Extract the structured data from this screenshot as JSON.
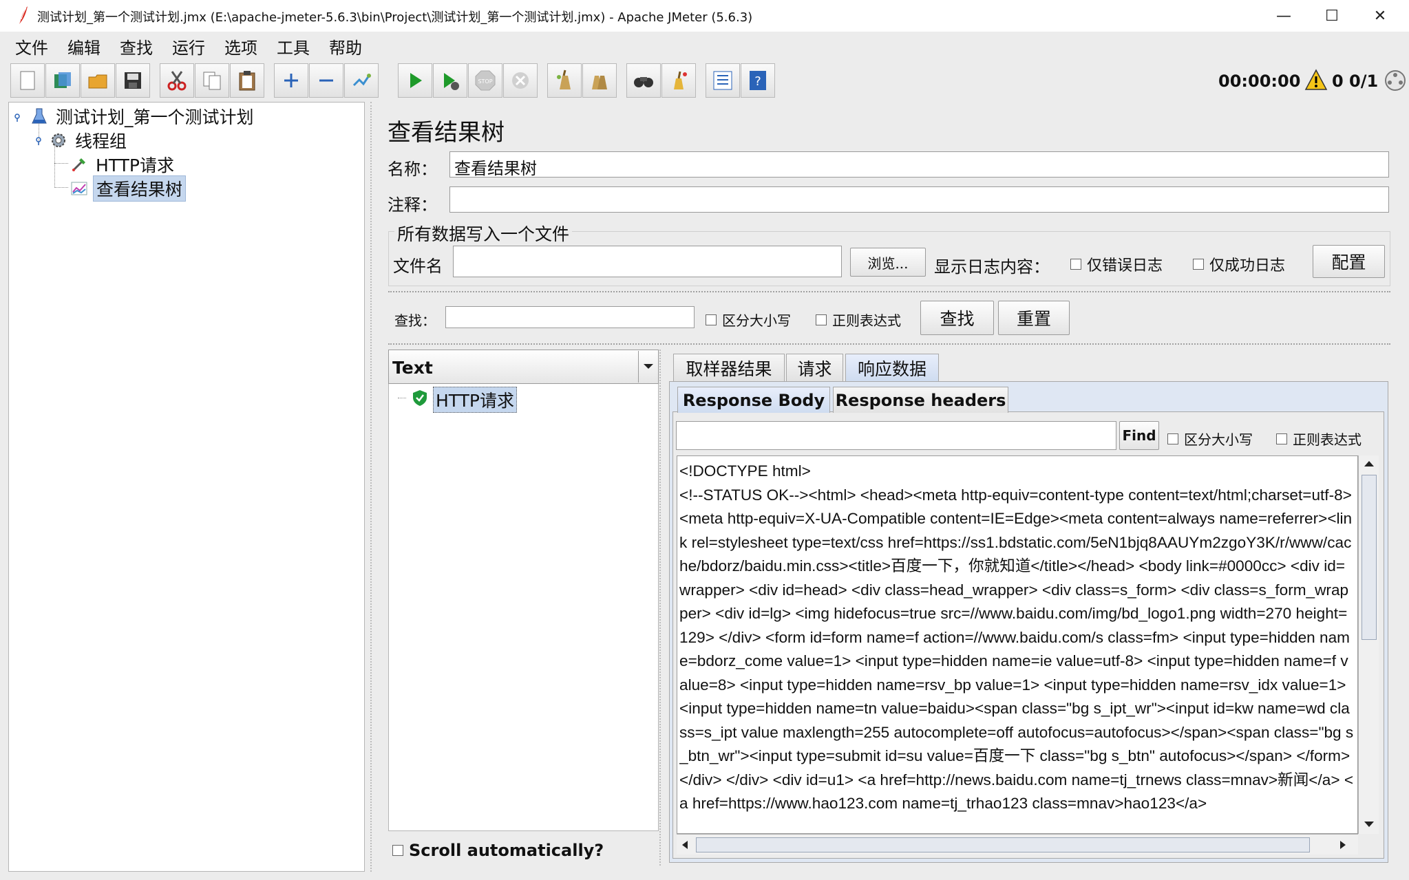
{
  "window": {
    "title": "测试计划_第一个测试计划.jmx (E:\\apache-jmeter-5.6.3\\bin\\Project\\测试计划_第一个测试计划.jmx) - Apache JMeter (5.6.3)",
    "minimize": "—",
    "maximize": "☐",
    "close": "✕"
  },
  "menu": [
    "文件",
    "编辑",
    "查找",
    "运行",
    "选项",
    "工具",
    "帮助"
  ],
  "toolbar": {
    "timer": "00:00:00",
    "error_count": "0",
    "threads": "0/1",
    "icons": [
      "new-icon",
      "templates-icon",
      "open-icon",
      "save-icon",
      "cut-icon",
      "copy-icon",
      "paste-icon",
      "expand-icon",
      "collapse-icon",
      "toggle-icon",
      "start-icon",
      "start-no-pause-icon",
      "stop-icon",
      "shutdown-icon",
      "clear-icon",
      "clear-all-icon",
      "search-icon",
      "reset-search-icon",
      "function-helper-icon",
      "help-icon"
    ]
  },
  "tree": {
    "items": [
      {
        "label": "测试计划_第一个测试计划",
        "icon": "test-plan-icon"
      },
      {
        "label": "线程组",
        "icon": "thread-group-icon"
      },
      {
        "label": "HTTP请求",
        "icon": "http-sampler-icon"
      },
      {
        "label": "查看结果树",
        "icon": "results-tree-icon"
      }
    ]
  },
  "panel": {
    "title": "查看结果树",
    "name_label": "名称：",
    "name_value": "查看结果树",
    "comment_label": "注释：",
    "comment_value": "",
    "file_group_title": "所有数据写入一个文件",
    "filename_label": "文件名",
    "filename_value": "",
    "browse_button": "浏览...",
    "log_label": "显示日志内容：",
    "errors_only": "仅错误日志",
    "success_only": "仅成功日志",
    "configure_button": "配置",
    "search_label": "查找：",
    "search_value": "",
    "case_sensitive": "区分大小写",
    "regex": "正则表达式",
    "search_button": "查找",
    "reset_button": "重置"
  },
  "results": {
    "renderer": "Text",
    "items": [
      "HTTP请求"
    ],
    "scroll_auto": "Scroll automatically?"
  },
  "tabs": {
    "main": [
      "取样器结果",
      "请求",
      "响应数据"
    ],
    "active_main": "响应数据",
    "sub": [
      "Response Body",
      "Response headers"
    ],
    "active_sub": "Response Body",
    "find_button": "Find",
    "find_case": "区分大小写",
    "find_regex": "正则表达式"
  },
  "response_body": "<!DOCTYPE html>\n<!--STATUS OK--><html> <head><meta http-equiv=content-type content=text/html;charset=utf-8><meta http-equiv=X-UA-Compatible content=IE=Edge><meta content=always name=referrer><link rel=stylesheet type=text/css href=https://ss1.bdstatic.com/5eN1bjq8AAUYm2zgoY3K/r/www/cache/bdorz/baidu.min.css><title>百度一下，你就知道</title></head> <body link=#0000cc> <div id=wrapper> <div id=head> <div class=head_wrapper> <div class=s_form> <div class=s_form_wrapper> <div id=lg> <img hidefocus=true src=//www.baidu.com/img/bd_logo1.png width=270 height=129> </div> <form id=form name=f action=//www.baidu.com/s class=fm> <input type=hidden name=bdorz_come value=1> <input type=hidden name=ie value=utf-8> <input type=hidden name=f value=8> <input type=hidden name=rsv_bp value=1> <input type=hidden name=rsv_idx value=1> <input type=hidden name=tn value=baidu><span class=\"bg s_ipt_wr\"><input id=kw name=wd class=s_ipt value maxlength=255 autocomplete=off autofocus=autofocus></span><span class=\"bg s_btn_wr\"><input type=submit id=su value=百度一下 class=\"bg s_btn\" autofocus></span> </form> </div> </div> <div id=u1> <a href=http://news.baidu.com name=tj_trnews class=mnav>新闻</a> <a href=https://www.hao123.com name=tj_trhao123 class=mnav>hao123</a>"
}
